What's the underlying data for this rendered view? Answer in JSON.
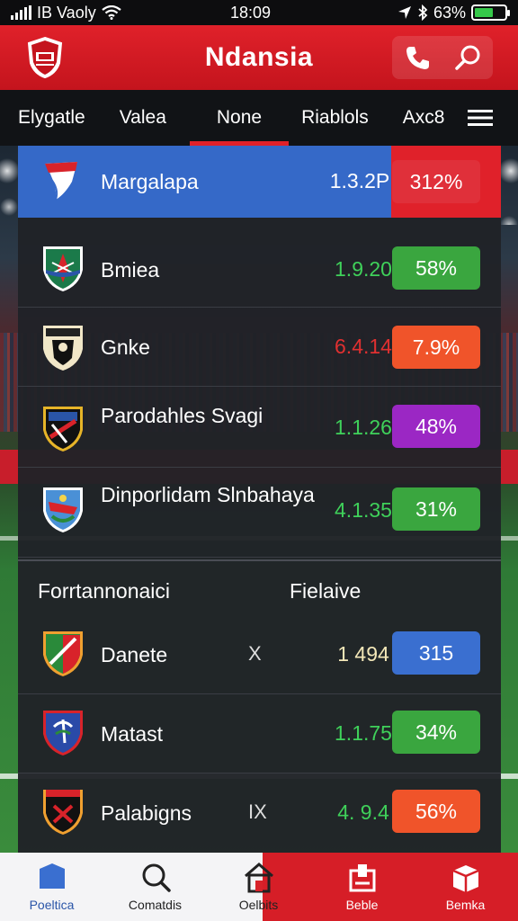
{
  "status_bar": {
    "carrier": "IB Vaoly",
    "time": "18:09",
    "battery": "63%",
    "battery_level": 0.63
  },
  "header": {
    "title": "Ndansia"
  },
  "tabs": [
    {
      "label": "Elygatle"
    },
    {
      "label": "Valea"
    },
    {
      "label": "None",
      "active": true
    },
    {
      "label": "Riablols"
    },
    {
      "label": "Axc8"
    }
  ],
  "rows": [
    {
      "name": "Margalapa",
      "odds": "1.3.2P",
      "pct": "312%",
      "odds_color": "#ffffff",
      "pill_color": "#e0212a",
      "highlight": true
    },
    {
      "name": "Bmiea",
      "odds": "1.9.20",
      "pct": "58%",
      "odds_color": "#3fd15a",
      "pill_color": "#3aa63f"
    },
    {
      "name": "Gnke",
      "odds": "6.4.14",
      "pct": "7.9%",
      "odds_color": "#e03030",
      "pill_color": "#f0542a"
    },
    {
      "name": "Parodahles Svagi",
      "odds": "1.1.26",
      "pct": "48%",
      "odds_color": "#3fd15a",
      "pill_color": "#9b27c4"
    },
    {
      "name": "Dinporlidam Slnbahaya",
      "odds": "4.1.35",
      "pct": "31%",
      "odds_color": "#3fd15a",
      "pill_color": "#3aa63f"
    }
  ],
  "section": {
    "left": "Forrtannonaici",
    "right": "Fielaive"
  },
  "rows2": [
    {
      "name": "Danete",
      "mark": "X",
      "odds": "1 494",
      "pct": "315",
      "odds_color": "#f3e7b8",
      "pill_color": "#3a6fd0"
    },
    {
      "name": "Matast",
      "odds": "1.1.75",
      "pct": "34%",
      "odds_color": "#3fd15a",
      "pill_color": "#3aa63f"
    },
    {
      "name": "Palabigns",
      "mark": "IX",
      "odds": "4. 9.4",
      "pct": "56%",
      "odds_color": "#3fd15a",
      "pill_color": "#f0542a"
    }
  ],
  "bottom_nav": [
    {
      "label": "Poeltica",
      "icon": "shield-icon"
    },
    {
      "label": "Comatdis",
      "icon": "search-icon"
    },
    {
      "label": "Oelbits",
      "icon": "home-icon"
    },
    {
      "label": "Beble",
      "icon": "clipboard-icon"
    },
    {
      "label": "Bemka",
      "icon": "box-icon"
    }
  ]
}
